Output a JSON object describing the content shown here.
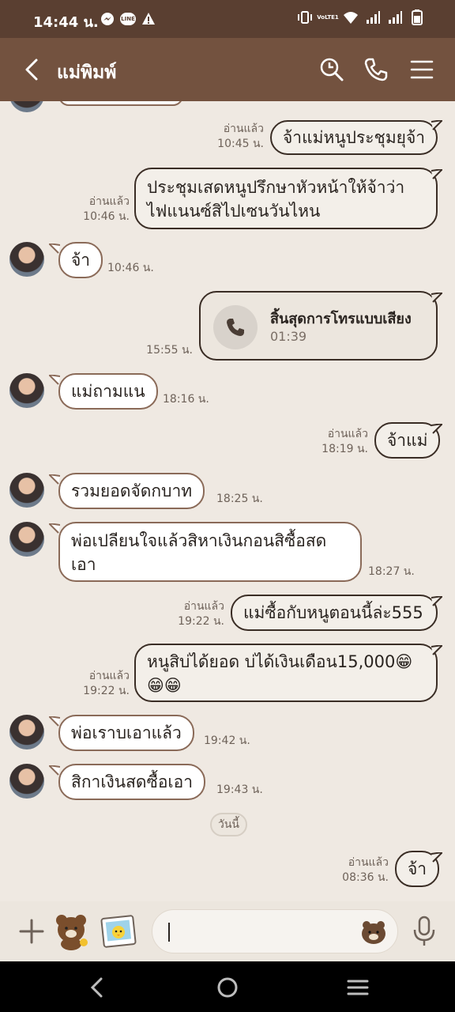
{
  "status_bar": {
    "time": "14:44 น.",
    "line_label": "LINE",
    "lte_label": "VoLTE1"
  },
  "header": {
    "title": "แม่พิมพ์"
  },
  "messages": [
    {
      "dir": "out",
      "text": "จ้าแม่หนูประชุมยุจ้า",
      "read": "อ่านแล้ว",
      "time": "10:45 น."
    },
    {
      "dir": "out",
      "lines": [
        "ประชุมเสดหนูปรึกษาหัวหน้าให้จ้าว่า",
        "ไฟแนนซ์สิไปเซนวันไหน"
      ],
      "read": "อ่านแล้ว",
      "time": "10:46 น."
    },
    {
      "dir": "in",
      "text": "จ้า",
      "time": "10:46 น."
    },
    {
      "dir": "out",
      "type": "call",
      "title": "สิ้นสุดการโทรแบบเสียง",
      "duration": "01:39",
      "time": "15:55 น."
    },
    {
      "dir": "in",
      "text": "แม่ถามแน",
      "time": "18:16 น."
    },
    {
      "dir": "out",
      "text": "จ้าแม่",
      "read": "อ่านแล้ว",
      "time": "18:19 น."
    },
    {
      "dir": "in",
      "text": "รวมยอดจัดกบาท",
      "time": "18:25 น."
    },
    {
      "dir": "in",
      "lines": [
        "พ่อเปลียนใจแล้วสิหาเงินกอนสิซื้อสด",
        "เอา"
      ],
      "time": "18:27 น."
    },
    {
      "dir": "out",
      "text": "แม่ซื้อกับหนูตอนนี้ล่ะ555",
      "read": "อ่านแล้ว",
      "time": "19:22 น."
    },
    {
      "dir": "out",
      "lines": [
        "หนูสิบ่ได้ยอด บ่ได้เงินเดือน15,000😁",
        "😁😁"
      ],
      "read": "อ่านแล้ว",
      "time": "19:22 น."
    },
    {
      "dir": "in",
      "text": "พ่อเราบเอาแล้ว",
      "time": "19:42 น."
    },
    {
      "dir": "in",
      "text": "สิกาเงินสดซื้อเอา",
      "time": "19:43 น."
    },
    {
      "dir": "out",
      "text": "จ้า",
      "read": "อ่านแล้ว",
      "time": "08:36 น."
    }
  ],
  "date_chip": "วันนี้",
  "colors": {
    "header": "#73523f",
    "status": "#5a3f31",
    "background": "#efe9e2"
  }
}
